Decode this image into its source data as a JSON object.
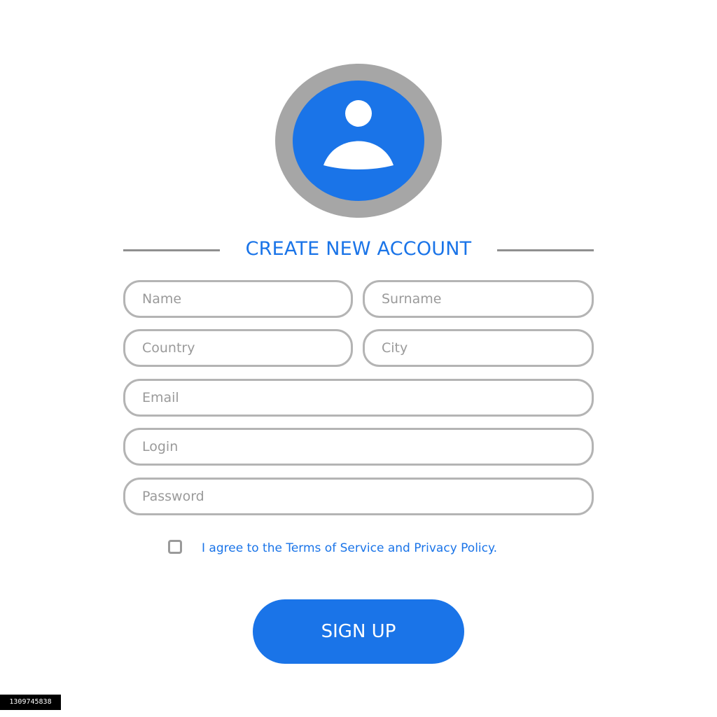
{
  "colors": {
    "accent": "#1a74e8",
    "field_border": "#b4b4b4",
    "avatar_ring": "#a6a6a6",
    "rule": "#8f8f8f"
  },
  "avatar": {
    "icon": "user-icon"
  },
  "heading": "CREATE NEW ACCOUNT",
  "fields": {
    "name": {
      "placeholder": "Name",
      "value": ""
    },
    "surname": {
      "placeholder": "Surname",
      "value": ""
    },
    "country": {
      "placeholder": "Country",
      "value": ""
    },
    "city": {
      "placeholder": "City",
      "value": ""
    },
    "email": {
      "placeholder": "Email",
      "value": ""
    },
    "login": {
      "placeholder": "Login",
      "value": ""
    },
    "password": {
      "placeholder": "Password",
      "value": ""
    }
  },
  "agreement": {
    "checked": false,
    "label": "I agree to the Terms of Service and Privacy Policy."
  },
  "signup_button": "SIGN UP",
  "stock_id": "1309745838"
}
